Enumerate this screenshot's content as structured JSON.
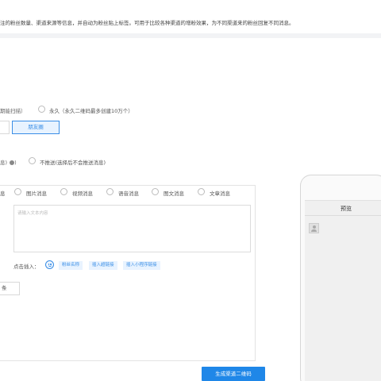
{
  "notice": "注的粉丝数量、渠道来源等信息，并自动为粉丝贴上标签。可用于比较各种渠道的增粉效果，为不同渠道来的粉丝回复不同消息。",
  "validity": {
    "temp_label_fragment": "期能扫描）",
    "permanent_label": "永久（永久二维码最多创建10万个）"
  },
  "channel": {
    "selected_button": "朋友圈"
  },
  "push": {
    "push_fragment": "息",
    "no_push_label": "不推送(选择后不会推送消息)"
  },
  "message_types": [
    {
      "label": "息",
      "icon": ""
    },
    {
      "label": "图片消息",
      "icon": "radio"
    },
    {
      "label": "视频消息",
      "icon": "radio"
    },
    {
      "label": "语音消息",
      "icon": "radio"
    },
    {
      "label": "图文消息",
      "icon": "radio"
    },
    {
      "label": "文章消息",
      "icon": "radio"
    }
  ],
  "editor": {
    "placeholder": "请输入文本内容"
  },
  "insert": {
    "label": "点击插入：",
    "emoji_icon": "smile-icon",
    "tags": [
      "粉丝名称",
      "插入超链接",
      "插入小程序链接"
    ]
  },
  "add_button": "条",
  "preview": {
    "title": "预览"
  },
  "generate_button": "生成渠道二维码",
  "colors": {
    "accent": "#1f87e8",
    "accent_light": "#e8f3ff"
  }
}
